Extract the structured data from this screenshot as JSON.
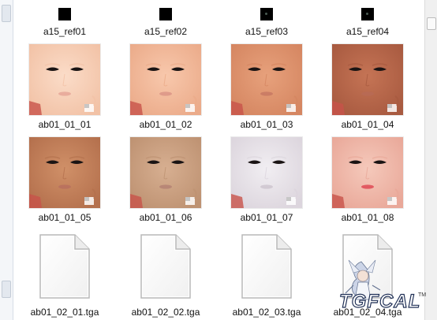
{
  "files": {
    "row1": [
      {
        "name": "a15_ref01"
      },
      {
        "name": "a15_ref02"
      },
      {
        "name": "a15_ref03"
      },
      {
        "name": "a15_ref04"
      }
    ],
    "row2": [
      {
        "name": "ab01_01_01",
        "skin": "#fbdcc8",
        "shade": "#f2c2a6",
        "lip": "#e7a89a"
      },
      {
        "name": "ab01_01_02",
        "skin": "#f8c8ac",
        "shade": "#ebab8a",
        "lip": "#dd9787"
      },
      {
        "name": "ab01_01_03",
        "skin": "#e7a17c",
        "shade": "#d58661",
        "lip": "#c97a64"
      },
      {
        "name": "ab01_01_04",
        "skin": "#c57455",
        "shade": "#a85a40",
        "lip": "#b86a55"
      }
    ],
    "row3": [
      {
        "name": "ab01_01_05",
        "skin": "#d09068",
        "shade": "#b4704d",
        "lip": "#b8705e"
      },
      {
        "name": "ab01_01_06",
        "skin": "#d7af91",
        "shade": "#be9272",
        "lip": "#b68474"
      },
      {
        "name": "ab01_01_07",
        "skin": "#f1eef2",
        "shade": "#dcd5dd",
        "lip": "#cfc7d0"
      },
      {
        "name": "ab01_01_08",
        "skin": "#f5c9bb",
        "shade": "#e9a899",
        "lip": "#e0505a"
      }
    ],
    "row4": [
      {
        "name": "ab01_02_01.tga"
      },
      {
        "name": "ab01_02_02.tga"
      },
      {
        "name": "ab01_02_03.tga"
      },
      {
        "name": "ab01_02_04.tga"
      }
    ]
  },
  "watermark": {
    "text": "TGFCAL",
    "tm": "TM"
  }
}
